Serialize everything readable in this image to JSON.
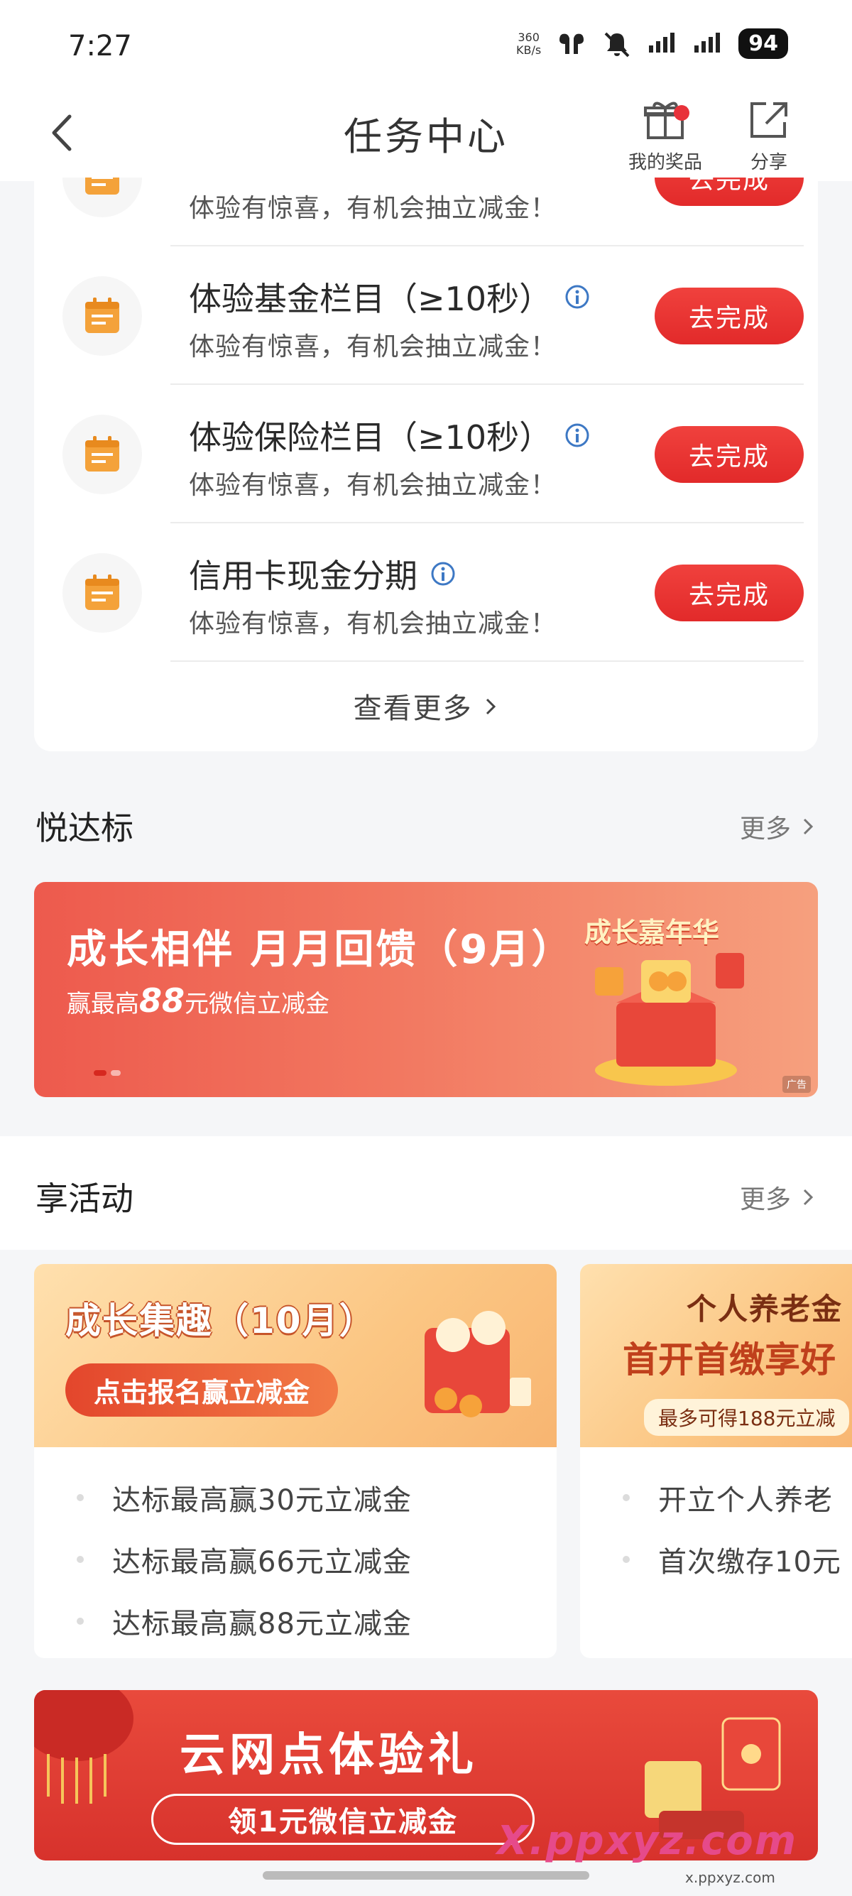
{
  "status_bar": {
    "time": "7:27",
    "net_speed_value": "360",
    "net_speed_unit": "KB/s",
    "battery": "94"
  },
  "nav": {
    "title": "任务中心",
    "prize_label": "我的奖品",
    "share_label": "分享"
  },
  "tasks": [
    {
      "title": "",
      "subtitle": "体验有惊喜，有机会抽立减金！",
      "button": "去完成"
    },
    {
      "title": "体验基金栏目（≥10秒）",
      "subtitle": "体验有惊喜，有机会抽立减金！",
      "button": "去完成"
    },
    {
      "title": "体验保险栏目（≥10秒）",
      "subtitle": "体验有惊喜，有机会抽立减金！",
      "button": "去完成"
    },
    {
      "title": "信用卡现金分期",
      "subtitle": "体验有惊喜，有机会抽立减金！",
      "button": "去完成"
    }
  ],
  "task_card": {
    "view_more": "查看更多"
  },
  "section_yuedabiao": {
    "title": "悦达标",
    "more": "更多"
  },
  "banner_growth": {
    "title": "成长相伴 月月回馈（9月）",
    "subtitle_prefix": "赢最高",
    "subtitle_amount": "88",
    "subtitle_suffix": "元微信立减金",
    "badge": "成长嘉年华",
    "ad_label": "广告"
  },
  "section_activities": {
    "title": "享活动",
    "more": "更多"
  },
  "activity_cards": [
    {
      "headline": "成长集趣（10月）",
      "pill": "点击报名赢立减金",
      "bullets": [
        "达标最高赢30元立减金",
        "达标最高赢66元立减金",
        "达标最高赢88元立减金"
      ]
    },
    {
      "headline": "个人养老金",
      "headline2": "首开首缴享好",
      "pill": "最多可得188元立减",
      "bullets": [
        "开立个人养老",
        "首次缴存10元"
      ]
    }
  ],
  "banner_cloud": {
    "title": "云网点体验礼",
    "subtitle": "领1元微信立减金"
  },
  "watermark": {
    "text": "X.ppxyz.com",
    "sub": "x.ppxyz.com"
  }
}
